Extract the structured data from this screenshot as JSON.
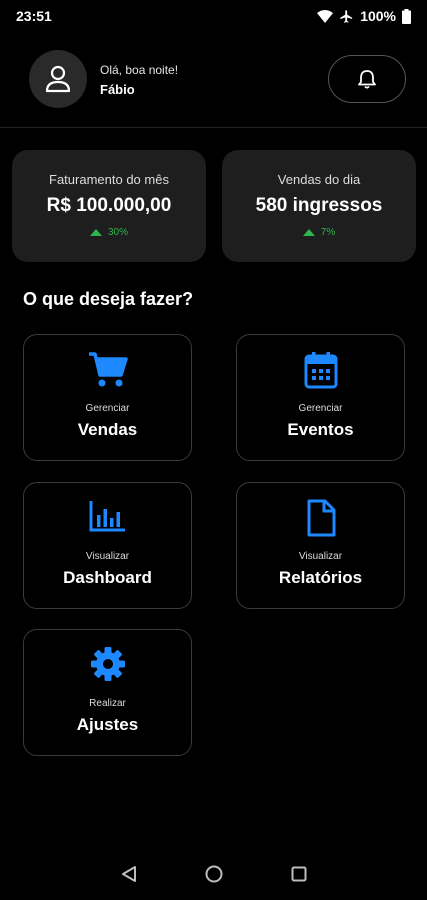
{
  "status_bar": {
    "time": "23:51",
    "battery": "100%"
  },
  "header": {
    "greeting": "Olá, boa noite!",
    "user_name": "Fábio"
  },
  "stats": [
    {
      "label": "Faturamento do mês",
      "value": "R$ 100.000,00",
      "delta": "30%"
    },
    {
      "label": "Vendas do dia",
      "value": "580 ingressos",
      "delta": "7%"
    }
  ],
  "section_title": "O que deseja fazer?",
  "actions": [
    {
      "sub": "Gerenciar",
      "main": "Vendas",
      "icon": "cart-icon"
    },
    {
      "sub": "Gerenciar",
      "main": "Eventos",
      "icon": "calendar-icon"
    },
    {
      "sub": "Visualizar",
      "main": "Dashboard",
      "icon": "bar-chart-icon"
    },
    {
      "sub": "Visualizar",
      "main": "Relatórios",
      "icon": "document-icon"
    },
    {
      "sub": "Realizar",
      "main": "Ajustes",
      "icon": "gear-icon"
    }
  ],
  "colors": {
    "accent": "#1e88ff",
    "positive": "#2fb54d",
    "card": "#1e1e1e"
  }
}
